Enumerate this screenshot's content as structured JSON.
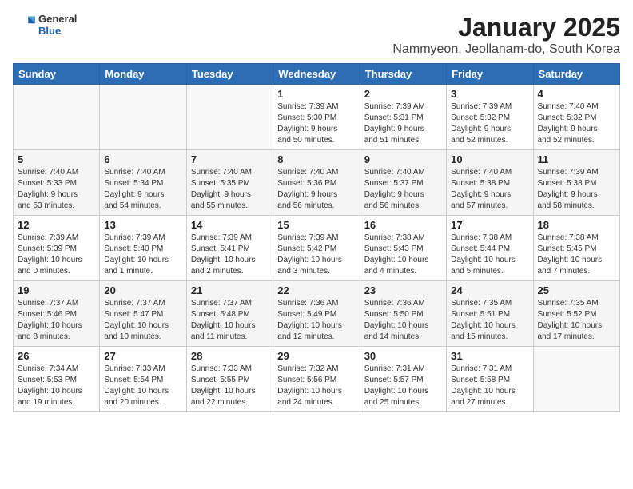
{
  "header": {
    "logo": {
      "line1": "General",
      "line2": "Blue"
    },
    "title": "January 2025",
    "location": "Nammyeon, Jeollanam-do, South Korea"
  },
  "days_of_week": [
    "Sunday",
    "Monday",
    "Tuesday",
    "Wednesday",
    "Thursday",
    "Friday",
    "Saturday"
  ],
  "weeks": [
    [
      {
        "day": "",
        "info": ""
      },
      {
        "day": "",
        "info": ""
      },
      {
        "day": "",
        "info": ""
      },
      {
        "day": "1",
        "info": "Sunrise: 7:39 AM\nSunset: 5:30 PM\nDaylight: 9 hours\nand 50 minutes."
      },
      {
        "day": "2",
        "info": "Sunrise: 7:39 AM\nSunset: 5:31 PM\nDaylight: 9 hours\nand 51 minutes."
      },
      {
        "day": "3",
        "info": "Sunrise: 7:39 AM\nSunset: 5:32 PM\nDaylight: 9 hours\nand 52 minutes."
      },
      {
        "day": "4",
        "info": "Sunrise: 7:40 AM\nSunset: 5:32 PM\nDaylight: 9 hours\nand 52 minutes."
      }
    ],
    [
      {
        "day": "5",
        "info": "Sunrise: 7:40 AM\nSunset: 5:33 PM\nDaylight: 9 hours\nand 53 minutes."
      },
      {
        "day": "6",
        "info": "Sunrise: 7:40 AM\nSunset: 5:34 PM\nDaylight: 9 hours\nand 54 minutes."
      },
      {
        "day": "7",
        "info": "Sunrise: 7:40 AM\nSunset: 5:35 PM\nDaylight: 9 hours\nand 55 minutes."
      },
      {
        "day": "8",
        "info": "Sunrise: 7:40 AM\nSunset: 5:36 PM\nDaylight: 9 hours\nand 56 minutes."
      },
      {
        "day": "9",
        "info": "Sunrise: 7:40 AM\nSunset: 5:37 PM\nDaylight: 9 hours\nand 56 minutes."
      },
      {
        "day": "10",
        "info": "Sunrise: 7:40 AM\nSunset: 5:38 PM\nDaylight: 9 hours\nand 57 minutes."
      },
      {
        "day": "11",
        "info": "Sunrise: 7:39 AM\nSunset: 5:38 PM\nDaylight: 9 hours\nand 58 minutes."
      }
    ],
    [
      {
        "day": "12",
        "info": "Sunrise: 7:39 AM\nSunset: 5:39 PM\nDaylight: 10 hours\nand 0 minutes."
      },
      {
        "day": "13",
        "info": "Sunrise: 7:39 AM\nSunset: 5:40 PM\nDaylight: 10 hours\nand 1 minute."
      },
      {
        "day": "14",
        "info": "Sunrise: 7:39 AM\nSunset: 5:41 PM\nDaylight: 10 hours\nand 2 minutes."
      },
      {
        "day": "15",
        "info": "Sunrise: 7:39 AM\nSunset: 5:42 PM\nDaylight: 10 hours\nand 3 minutes."
      },
      {
        "day": "16",
        "info": "Sunrise: 7:38 AM\nSunset: 5:43 PM\nDaylight: 10 hours\nand 4 minutes."
      },
      {
        "day": "17",
        "info": "Sunrise: 7:38 AM\nSunset: 5:44 PM\nDaylight: 10 hours\nand 5 minutes."
      },
      {
        "day": "18",
        "info": "Sunrise: 7:38 AM\nSunset: 5:45 PM\nDaylight: 10 hours\nand 7 minutes."
      }
    ],
    [
      {
        "day": "19",
        "info": "Sunrise: 7:37 AM\nSunset: 5:46 PM\nDaylight: 10 hours\nand 8 minutes."
      },
      {
        "day": "20",
        "info": "Sunrise: 7:37 AM\nSunset: 5:47 PM\nDaylight: 10 hours\nand 10 minutes."
      },
      {
        "day": "21",
        "info": "Sunrise: 7:37 AM\nSunset: 5:48 PM\nDaylight: 10 hours\nand 11 minutes."
      },
      {
        "day": "22",
        "info": "Sunrise: 7:36 AM\nSunset: 5:49 PM\nDaylight: 10 hours\nand 12 minutes."
      },
      {
        "day": "23",
        "info": "Sunrise: 7:36 AM\nSunset: 5:50 PM\nDaylight: 10 hours\nand 14 minutes."
      },
      {
        "day": "24",
        "info": "Sunrise: 7:35 AM\nSunset: 5:51 PM\nDaylight: 10 hours\nand 15 minutes."
      },
      {
        "day": "25",
        "info": "Sunrise: 7:35 AM\nSunset: 5:52 PM\nDaylight: 10 hours\nand 17 minutes."
      }
    ],
    [
      {
        "day": "26",
        "info": "Sunrise: 7:34 AM\nSunset: 5:53 PM\nDaylight: 10 hours\nand 19 minutes."
      },
      {
        "day": "27",
        "info": "Sunrise: 7:33 AM\nSunset: 5:54 PM\nDaylight: 10 hours\nand 20 minutes."
      },
      {
        "day": "28",
        "info": "Sunrise: 7:33 AM\nSunset: 5:55 PM\nDaylight: 10 hours\nand 22 minutes."
      },
      {
        "day": "29",
        "info": "Sunrise: 7:32 AM\nSunset: 5:56 PM\nDaylight: 10 hours\nand 24 minutes."
      },
      {
        "day": "30",
        "info": "Sunrise: 7:31 AM\nSunset: 5:57 PM\nDaylight: 10 hours\nand 25 minutes."
      },
      {
        "day": "31",
        "info": "Sunrise: 7:31 AM\nSunset: 5:58 PM\nDaylight: 10 hours\nand 27 minutes."
      },
      {
        "day": "",
        "info": ""
      }
    ]
  ]
}
